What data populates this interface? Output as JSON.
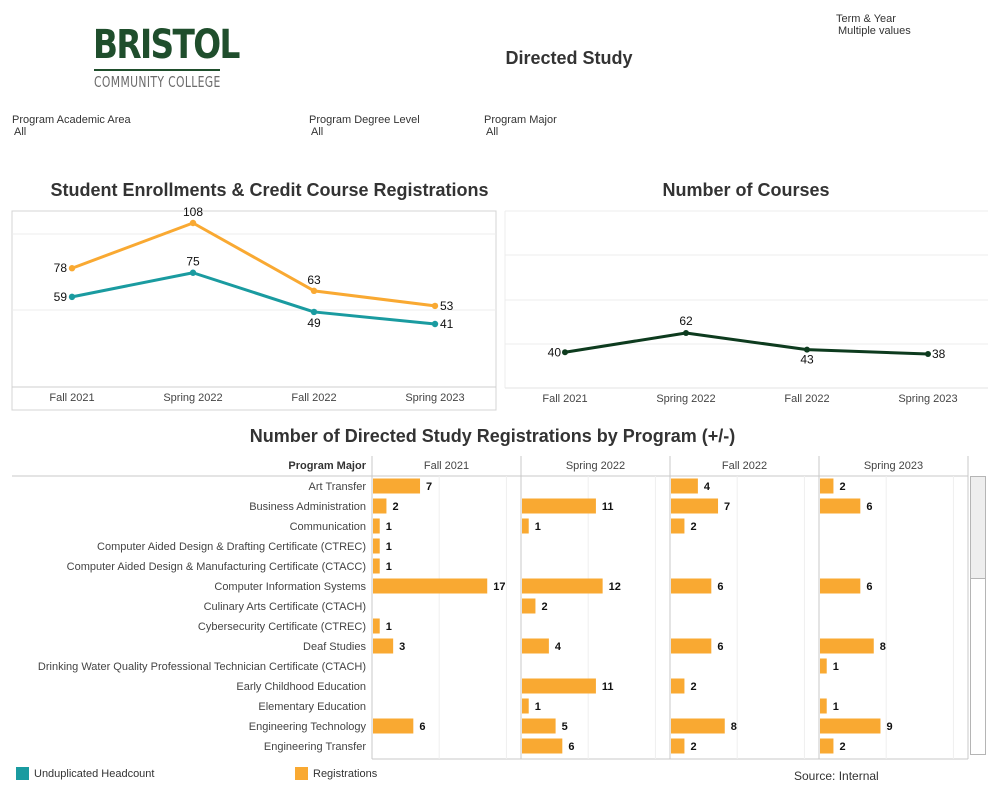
{
  "header": {
    "logo_main": "BRISTOL",
    "logo_sub": "COMMUNITY COLLEGE",
    "title": "Directed Study",
    "term_filter": {
      "label": "Term & Year",
      "value": "Multiple values"
    }
  },
  "filters": [
    {
      "label": "Program Academic Area",
      "value": "All"
    },
    {
      "label": "Program Degree Level",
      "value": "All"
    },
    {
      "label": "Program Major",
      "value": "All"
    }
  ],
  "colors": {
    "headcount": "#1a9ba0",
    "registrations": "#f9a932",
    "courses": "#0d3b1e",
    "brand": "#1f4e2c"
  },
  "legend": {
    "headcount_label": "Unduplicated Headcount",
    "registrations_label": "Registrations"
  },
  "source": "Source: Internal",
  "chart_data": [
    {
      "type": "line",
      "title": "Student Enrollments & Credit Course Registrations",
      "categories": [
        "Fall 2021",
        "Spring 2022",
        "Fall 2022",
        "Spring 2023"
      ],
      "series": [
        {
          "name": "Registrations",
          "values": [
            78,
            108,
            63,
            53
          ]
        },
        {
          "name": "Unduplicated Headcount",
          "values": [
            59,
            75,
            49,
            41
          ]
        }
      ],
      "xlabel": "",
      "ylabel": "",
      "ylim": [
        0,
        120
      ],
      "grid": true,
      "legend": "bottom-left"
    },
    {
      "type": "line",
      "title": "Number of Courses",
      "categories": [
        "Fall 2021",
        "Spring 2022",
        "Fall 2022",
        "Spring 2023"
      ],
      "series": [
        {
          "name": "Courses",
          "values": [
            40,
            62,
            43,
            38
          ]
        }
      ],
      "xlabel": "",
      "ylabel": "",
      "ylim": [
        0,
        200
      ],
      "grid": true
    },
    {
      "type": "bar",
      "title": "Number of Directed Study Registrations by Program  (+/-)",
      "row_header": "Program Major",
      "columns": [
        "Fall 2021",
        "Spring 2022",
        "Fall 2022",
        "Spring 2023"
      ],
      "rows": [
        {
          "label": "Art Transfer",
          "values": [
            7,
            null,
            4,
            2
          ]
        },
        {
          "label": "Business Administration",
          "values": [
            2,
            11,
            7,
            6
          ]
        },
        {
          "label": "Communication",
          "values": [
            1,
            1,
            2,
            null
          ]
        },
        {
          "label": "Computer Aided Design & Drafting Certificate (CTREC)",
          "values": [
            1,
            null,
            null,
            null
          ]
        },
        {
          "label": "Computer Aided Design & Manufacturing Certificate (CTACC)",
          "values": [
            1,
            null,
            null,
            null
          ]
        },
        {
          "label": "Computer Information Systems",
          "values": [
            17,
            12,
            6,
            6
          ]
        },
        {
          "label": "Culinary Arts Certificate (CTACH)",
          "values": [
            null,
            2,
            null,
            null
          ]
        },
        {
          "label": "Cybersecurity Certificate (CTREC)",
          "values": [
            1,
            null,
            null,
            null
          ]
        },
        {
          "label": "Deaf Studies",
          "values": [
            3,
            4,
            6,
            8
          ]
        },
        {
          "label": "Drinking Water Quality Professional Technician Certificate (CTACH)",
          "values": [
            null,
            null,
            null,
            1
          ]
        },
        {
          "label": "Early Childhood Education",
          "values": [
            null,
            11,
            2,
            null
          ]
        },
        {
          "label": "Elementary Education",
          "values": [
            null,
            1,
            null,
            1
          ]
        },
        {
          "label": "Engineering Technology",
          "values": [
            6,
            5,
            8,
            9
          ]
        },
        {
          "label": "Engineering Transfer",
          "values": [
            null,
            6,
            2,
            2
          ]
        }
      ],
      "xlim": [
        0,
        22
      ],
      "grid": true
    }
  ]
}
